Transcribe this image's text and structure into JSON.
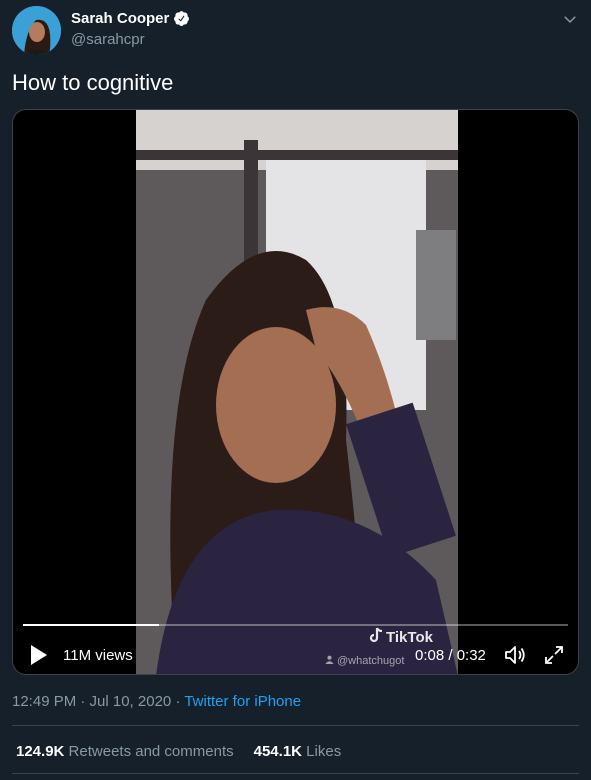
{
  "author": {
    "name": "Sarah Cooper",
    "handle": "@sarahcpr"
  },
  "tweet": {
    "text": "How to cognitive"
  },
  "video": {
    "views": "11M views",
    "time": "0:08 / 0:32",
    "progress": 0.25,
    "tiktok_label": "TikTok",
    "tiktok_user": "@whatchugot"
  },
  "meta": {
    "timestamp": "12:49 PM · Jul 10, 2020",
    "separator": "·",
    "source": "Twitter for iPhone"
  },
  "stats": {
    "retweets_count": "124.9K",
    "retweets_label": "Retweets and comments",
    "likes_count": "454.1K",
    "likes_label": "Likes"
  },
  "colors": {
    "background": "#15202b",
    "accent": "#1da1f2",
    "secondary_text": "#8899a6"
  }
}
